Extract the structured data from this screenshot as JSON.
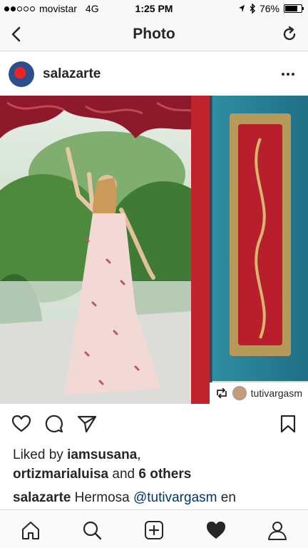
{
  "status": {
    "carrier": "movistar",
    "network": "4G",
    "time": "1:25 PM",
    "battery": "76%",
    "battery_level": 0.76
  },
  "nav": {
    "title": "Photo"
  },
  "post": {
    "username": "salazarte",
    "repost_user": "tutivargasm",
    "likes": {
      "prefix": "Liked by",
      "user1": "iamsusana",
      "sep": ",",
      "user2": "ortizmarialuisa",
      "and": "and",
      "others": "6 others"
    },
    "caption": {
      "user": "salazarte",
      "text1": "Hermosa",
      "mention": "@tutivargasm",
      "text2": "en"
    }
  },
  "icons": {
    "back": "chevron-left-icon",
    "refresh": "refresh-icon",
    "more": "more-dots-icon",
    "like": "heart-icon",
    "comment": "comment-icon",
    "share": "send-icon",
    "save": "bookmark-icon",
    "home": "home-icon",
    "search": "search-icon",
    "add": "add-icon",
    "activity": "heart-filled-icon",
    "profile": "profile-icon"
  },
  "colors": {
    "mention": "#003569",
    "text": "#262626"
  }
}
